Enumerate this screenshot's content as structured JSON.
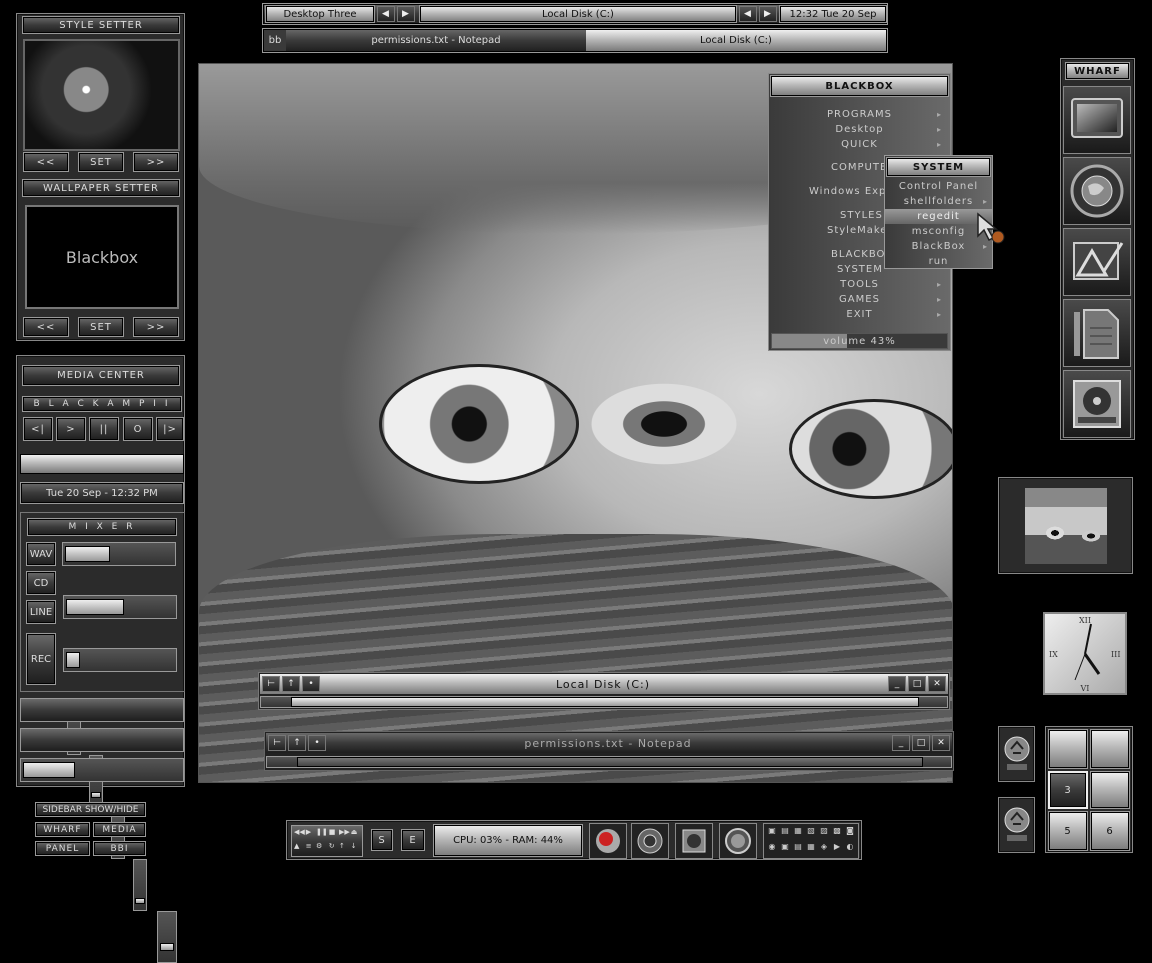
{
  "topbar": {
    "workspace": "Desktop Three",
    "window_title": "Local Disk (C:)",
    "clock": "12:32 Tue 20 Sep",
    "bb_label": "bb",
    "tasks": [
      "permissions.txt - Notepad",
      "Local Disk (C:)"
    ]
  },
  "style_setter": {
    "title": "STYLE SETTER",
    "prev": "<<",
    "set": "SET",
    "next": ">>"
  },
  "wallpaper_setter": {
    "title": "WALLPAPER SETTER",
    "preview_text": "Blackbox",
    "prev": "<<",
    "set": "SET",
    "next": ">>"
  },
  "media_center": {
    "title": "MEDIA CENTER",
    "player": "B L A C K A M P  I I",
    "controls": [
      "<|",
      ">",
      "||",
      "O",
      "|>"
    ],
    "datetime": "Tue 20 Sep - 12:32 PM",
    "mixer_title": "M I X E R",
    "channels": [
      {
        "label": "WAV",
        "level": 0.42
      },
      {
        "label": "CD",
        "level": 0.55
      },
      {
        "label": "LINE",
        "level": 0.1
      }
    ],
    "rec_label": "REC",
    "rec_levels": [
      0.1,
      0.15,
      0.2,
      0.1,
      0.25
    ]
  },
  "sidebar_toggle": {
    "title": "SIDEBAR SHOW/HIDE",
    "buttons": [
      "WHARF",
      "MEDIA",
      "PANEL",
      "BBI"
    ]
  },
  "blackbox_menu": {
    "title": "BLACKBOX",
    "items": [
      "PROGRAMS",
      "Desktop",
      "QUICK",
      "COMPUTER",
      "Windows Exp",
      "STYLES",
      "StyleMake",
      "BLACKBOX",
      "SYSTEM",
      "TOOLS",
      "GAMES",
      "EXIT"
    ],
    "volume": "volume 43%"
  },
  "system_menu": {
    "title": "SYSTEM",
    "items": [
      "Control Panel",
      "shellfolders",
      "regedit",
      "msconfig",
      "BlackBox",
      "run"
    ],
    "selected": "regedit"
  },
  "wharf": {
    "title": "WHARF",
    "icons": [
      "monitor-icon",
      "globe-icon",
      "graphics-icon",
      "document-icon",
      "disk-icon"
    ]
  },
  "windows": [
    {
      "title": "Local Disk (C:)",
      "progress": 0.03
    },
    {
      "title": "permissions.txt - Notepad",
      "progress": 0.05
    }
  ],
  "clock_widget": {
    "numerals": [
      "XII",
      "III",
      "VI",
      "IX"
    ]
  },
  "pager": {
    "desks": [
      "",
      "",
      "3",
      "",
      "5",
      "6"
    ],
    "active": "3"
  },
  "bottom_bar": {
    "s_button": "S",
    "e_button": "E",
    "status": "CPU: 03% - RAM: 44%"
  }
}
